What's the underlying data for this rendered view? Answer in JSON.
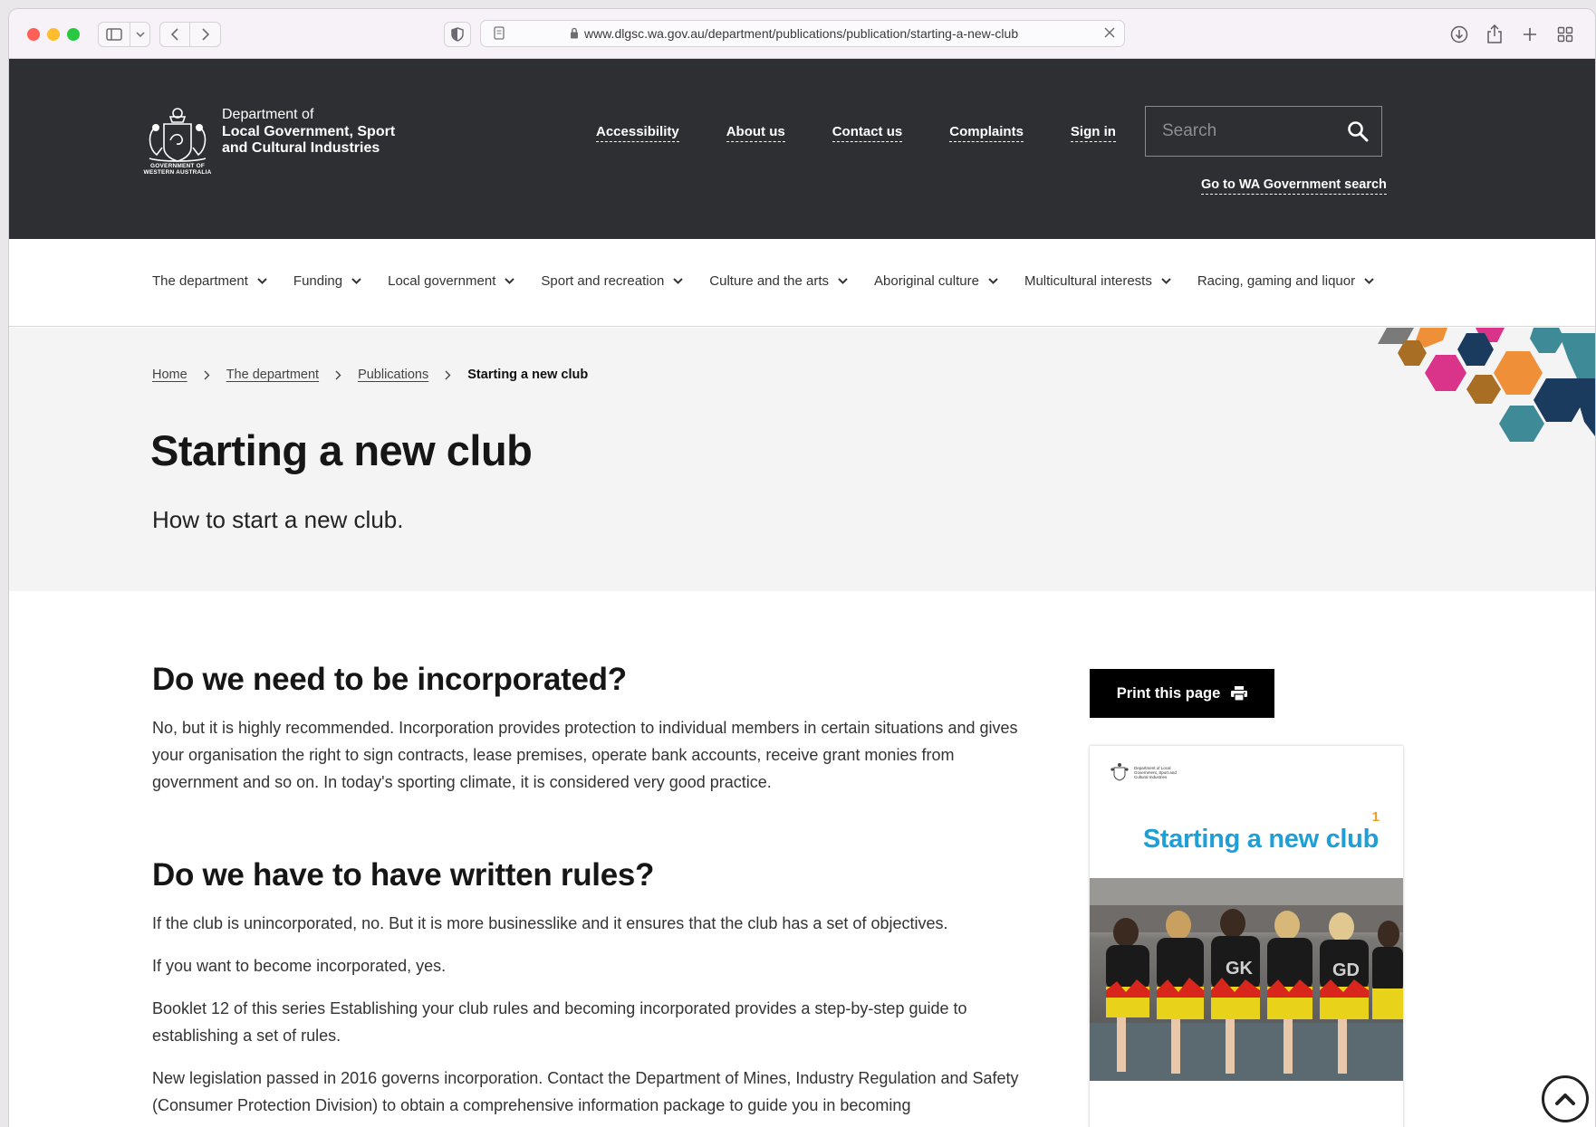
{
  "browser": {
    "url": "www.dlgsc.wa.gov.au/department/publications/publication/starting-a-new-club"
  },
  "header": {
    "crest_caption": "GOVERNMENT OF WESTERN AUSTRALIA",
    "dept_line1": "Department of",
    "dept_line2": "Local Government, Sport",
    "dept_line3": "and Cultural Industries",
    "util_links": [
      "Accessibility",
      "About us",
      "Contact us",
      "Complaints",
      "Sign in"
    ],
    "search_placeholder": "Search",
    "wa_search_label": "Go to WA Government search"
  },
  "nav": {
    "items": [
      "The department",
      "Funding",
      "Local government",
      "Sport and recreation",
      "Culture and the arts",
      "Aboriginal culture",
      "Multicultural interests",
      "Racing, gaming and liquor"
    ]
  },
  "breadcrumb": {
    "home": "Home",
    "department": "The department",
    "publications": "Publications",
    "current": "Starting a new club"
  },
  "hero": {
    "title": "Starting a new club",
    "subtitle": "How to start a new club."
  },
  "article": {
    "h1": "Do we need to be incorporated?",
    "p1": "No, but it is highly recommended. Incorporation provides protection to individual members in certain situations and gives your organisation the right to sign contracts, lease premises, operate bank accounts, receive grant monies from government and so on. In today's sporting climate, it is considered very good practice.",
    "h2": "Do we have to have written rules?",
    "p2": "If the club is unincorporated, no. But it is more businesslike and it ensures that the club has a set of objectives.",
    "p3": "If you want to become incorporated, yes.",
    "p4": "Booklet 12 of this series Establishing your club rules and becoming incorporated provides a step-by-step guide to establishing a set of rules.",
    "p5": "New legislation passed in 2016 governs incorporation. Contact the Department of Mines, Industry Regulation and Safety (Consumer Protection Division) to obtain a comprehensive information package to guide you in becoming"
  },
  "sidebar": {
    "print_label": "Print this page",
    "booklet_logo_text": "Department of Local Government, Sport and Cultural Industries",
    "booklet_number": "1",
    "booklet_title": "Starting a new club"
  },
  "colors": {
    "header_bg": "#2d2f33",
    "hero_bg": "#f4f4f4",
    "booklet_title": "#1e9fd8",
    "hex_orange": "#ef8f37",
    "hex_pink": "#d9338a",
    "hex_navy": "#1a3b5e",
    "hex_teal": "#3f8a97",
    "hex_brown": "#a86f24"
  }
}
